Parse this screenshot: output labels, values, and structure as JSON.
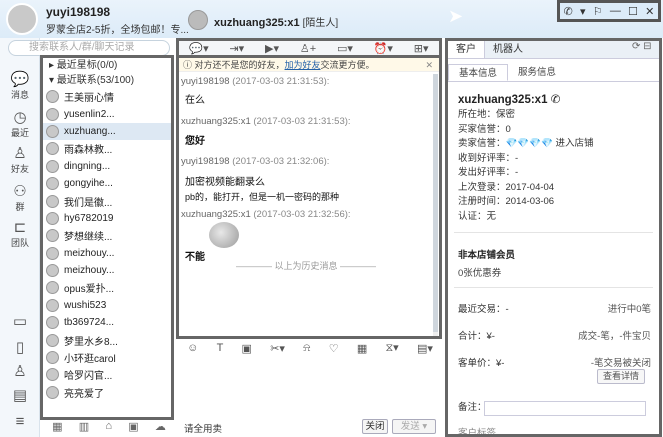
{
  "header": {
    "username": "yuyi198198",
    "signature": "罗蒙全店2-5折，全场包邮！专...",
    "chat_name": "xuzhuang325:x1",
    "chat_tag": "[陌生人]",
    "window_controls": [
      "phone-icon",
      "menu-icon",
      "skin-icon",
      "minimize-icon",
      "maximize-icon",
      "close-icon"
    ]
  },
  "search": {
    "placeholder": "搜索联系人/群/聊天记录"
  },
  "left_nav": [
    {
      "label": "消息",
      "icon": "message-icon"
    },
    {
      "label": "最近",
      "icon": "clock-icon"
    },
    {
      "label": "好友",
      "icon": "friends-icon"
    },
    {
      "label": "群",
      "icon": "group-icon"
    },
    {
      "label": "团队",
      "icon": "team-icon"
    }
  ],
  "contacts": {
    "groups": [
      {
        "label": "最近星标(0/0)"
      },
      {
        "label": "最近联系(53/100)"
      }
    ],
    "items": [
      "王美丽心情",
      "yusenlin2...",
      "xuzhuang...",
      "雨森林教...",
      "dingning...",
      "gongyihe...",
      "我们是徽...",
      "hy6782019",
      "梦想继续...",
      "meizhouy...",
      "meizhouy...",
      "opus爱扑...",
      "wushi523",
      "tb369724...",
      "梦里水乡8...",
      "小环逛carol",
      "哈罗闪官...",
      "亮亮爱了"
    ]
  },
  "chat": {
    "notice": "对方还不是您的好友，",
    "notice_link": "加为好友",
    "notice_tail": "交流更方便。",
    "messages": [
      {
        "sender": "yuyi198198",
        "time": "(2017-03-03 21:31:53):",
        "text": "在么"
      },
      {
        "sender": "xuzhuang325:x1",
        "time": "(2017-03-03 21:31:53):",
        "text": "您好"
      },
      {
        "sender": "yuyi198198",
        "time": "(2017-03-03 21:32:06):",
        "text": "加密视频能翻录么",
        "text2": "pb的，能打开，但是一机一密码的那种"
      },
      {
        "sender": "xuzhuang325:x1",
        "time": "(2017-03-03 21:32:56):",
        "text": "不能"
      }
    ],
    "history_label": "以上为历史消息"
  },
  "input": {
    "quick_reply": "请全用卖",
    "close_label": "关闭",
    "send_label": "发送"
  },
  "right": {
    "tabs": [
      "客户",
      "机器人"
    ],
    "subtabs": [
      "基本信息",
      "服务信息"
    ],
    "name": "xuzhuang325:x1",
    "rows": [
      "所在地：保密",
      "买家信誉：0",
      "卖家信誉：💎💎💎💎  进入店铺",
      "收到好评率：-",
      "发出好评率：-",
      "上次登录：2017-04-04",
      "注册时间：2014-03-06",
      "认证：无"
    ],
    "member_title": "非本店铺会员",
    "coupon": "0张优惠券",
    "recent_trade": "最近交易：-",
    "in_progress": "进行中0笔",
    "total": "合计：¥-",
    "total_right": "成交-笔，-件宝贝",
    "avg": "客单价：¥-",
    "avg_right": "-笔交易被关闭",
    "detail_btn": "查看详情",
    "note_label": "备注：",
    "tag_label": "客户标签"
  }
}
